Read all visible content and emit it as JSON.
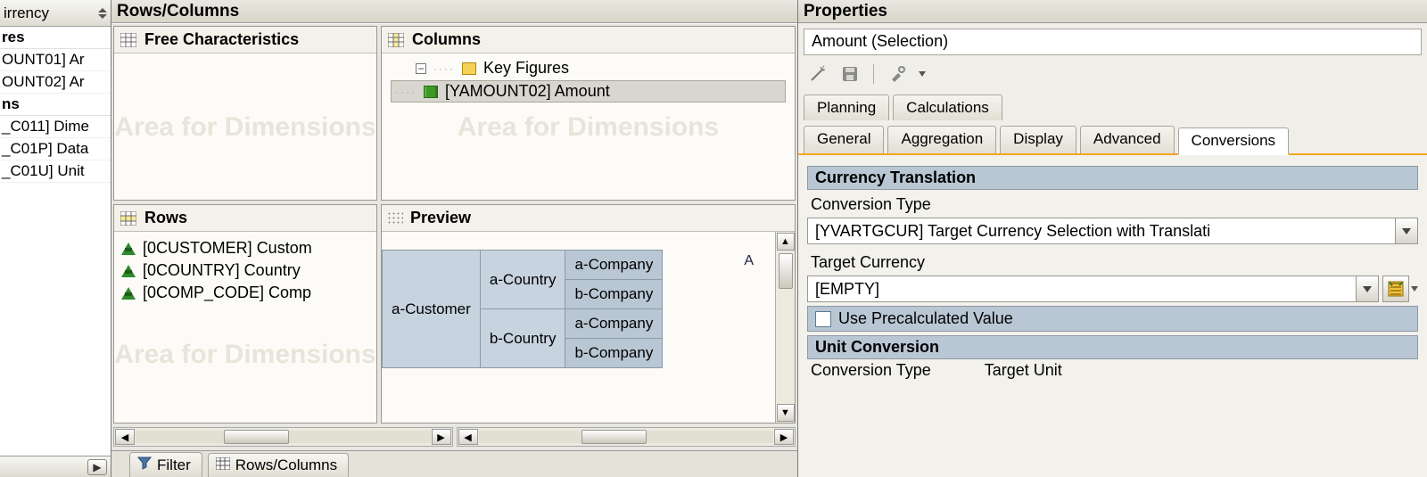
{
  "left": {
    "header": "irrency",
    "groups": [
      {
        "label": "res",
        "items": [
          "OUNT01] Ar",
          "OUNT02] Ar"
        ]
      },
      {
        "label": "ns",
        "items": [
          "_C011] Dime",
          "_C01P] Data",
          "_C01U] Unit"
        ]
      }
    ]
  },
  "mid": {
    "title": "Rows/Columns",
    "free": {
      "title": "Free Characteristics",
      "watermark": "Area for Dimensions"
    },
    "columns": {
      "title": "Columns",
      "kf_label": "Key Figures",
      "selected": "[YAMOUNT02] Amount",
      "watermark": "Area for Dimensions"
    },
    "rows": {
      "title": "Rows",
      "items": [
        "[0CUSTOMER] Custom",
        "[0COUNTRY] Country",
        "[0COMP_CODE] Comp"
      ],
      "watermark": "Area for Dimensions"
    },
    "preview": {
      "title": "Preview",
      "corner": "A",
      "cells": {
        "customer": "a-Customer",
        "country_a": "a-Country",
        "country_b": "b-Country",
        "company_a": "a-Company",
        "company_b": "b-Company"
      }
    },
    "bottom_tabs": {
      "filter": "Filter",
      "rowscols": "Rows/Columns"
    }
  },
  "right": {
    "title": "Properties",
    "name": "Amount (Selection)",
    "tabs": {
      "planning": "Planning",
      "calculations": "Calculations",
      "general": "General",
      "aggregation": "Aggregation",
      "display": "Display",
      "advanced": "Advanced",
      "conversions": "Conversions"
    },
    "currency": {
      "header": "Currency Translation",
      "type_label": "Conversion Type",
      "type_value": "[YVARTGCUR] Target Currency Selection with Translati",
      "target_label": "Target Currency",
      "target_value": "[EMPTY]",
      "precalc_label": "Use Precalculated Value"
    },
    "unit": {
      "header": "Unit Conversion",
      "type_label": "Conversion Type",
      "target_label": "Target Unit"
    }
  }
}
